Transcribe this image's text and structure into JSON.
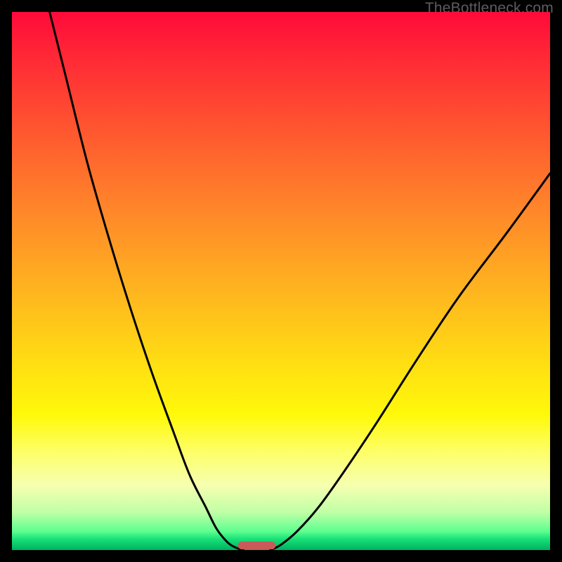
{
  "watermark": "TheBottleneck.com",
  "chart_data": {
    "type": "line",
    "title": "",
    "xlabel": "",
    "ylabel": "",
    "xlim": [
      0,
      100
    ],
    "ylim": [
      0,
      100
    ],
    "series": [
      {
        "name": "left-curve",
        "x": [
          7,
          10,
          14,
          18,
          22,
          26,
          30,
          33,
          36,
          38,
          40,
          41.5,
          43
        ],
        "y": [
          100,
          88,
          72,
          58,
          45,
          33,
          22,
          14,
          8,
          4,
          1.5,
          0.5,
          0
        ]
      },
      {
        "name": "right-curve",
        "x": [
          48,
          50,
          53,
          57,
          62,
          68,
          75,
          83,
          92,
          100
        ],
        "y": [
          0,
          1,
          3.5,
          8,
          15,
          24,
          35,
          47,
          59,
          70
        ]
      }
    ],
    "marker": {
      "name": "highlight-bar",
      "x_start": 42,
      "x_end": 49,
      "color": "#c85a5a"
    },
    "background": {
      "type": "vertical-gradient",
      "stops": [
        {
          "pos": 0.0,
          "color": "#ff0a3a"
        },
        {
          "pos": 0.5,
          "color": "#ffb51f"
        },
        {
          "pos": 0.75,
          "color": "#fff90a"
        },
        {
          "pos": 0.98,
          "color": "#17e077"
        },
        {
          "pos": 1.0,
          "color": "#00b060"
        }
      ]
    }
  }
}
